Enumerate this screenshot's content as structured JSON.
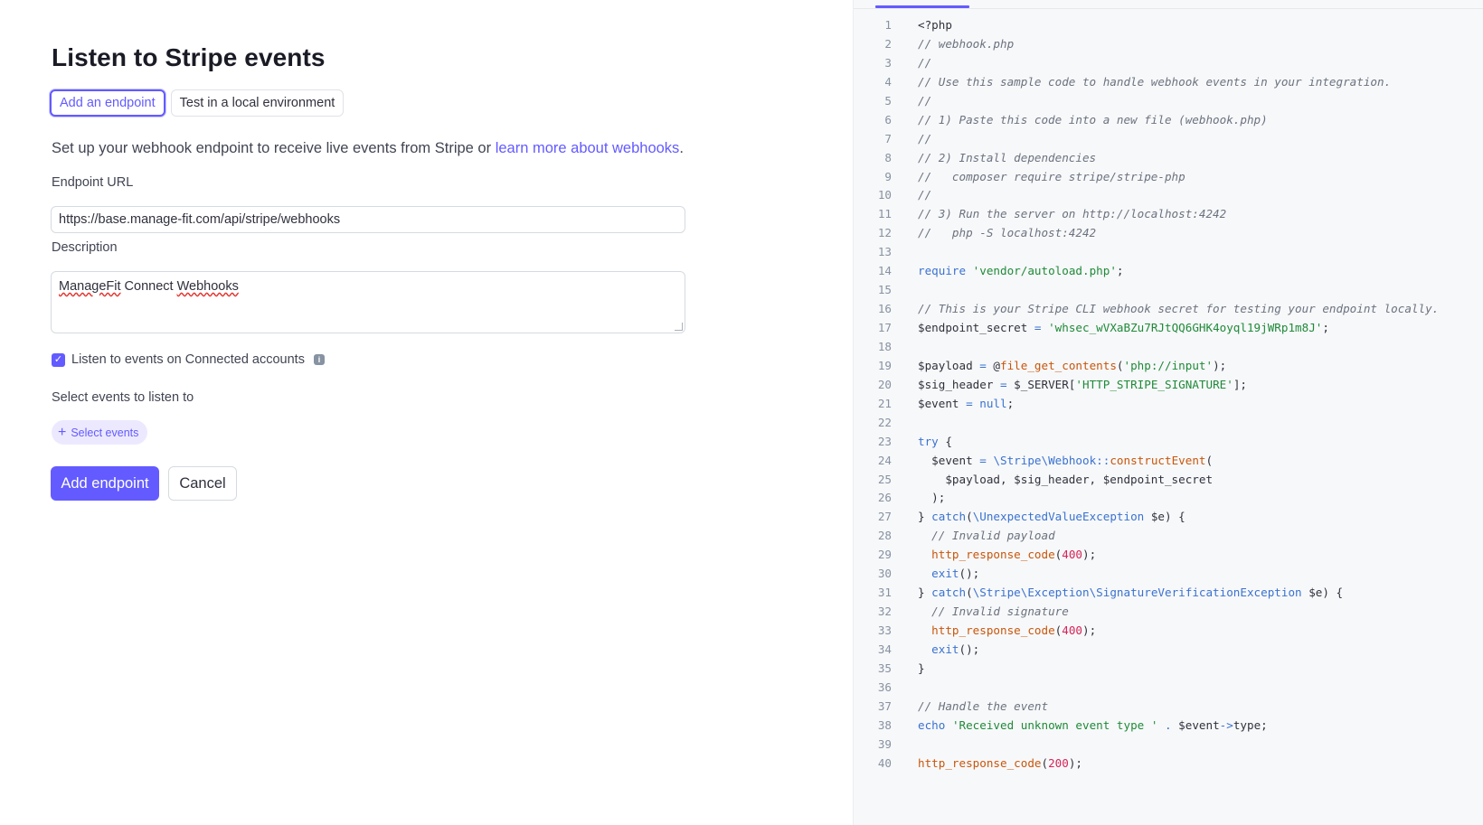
{
  "page": {
    "title": "Listen to Stripe events",
    "tabs": [
      {
        "label": "Add an endpoint",
        "active": true
      },
      {
        "label": "Test in a local environment",
        "active": false
      }
    ],
    "intro_text": "Set up your webhook endpoint to receive live events from Stripe or ",
    "intro_link": "learn more about webhooks",
    "intro_end": "."
  },
  "form": {
    "endpoint_label": "Endpoint URL",
    "endpoint_value": "https://base.manage-fit.com/api/stripe/webhooks",
    "description_label": "Description",
    "description_value_part1": "ManageFit",
    "description_value_part2": " Connect ",
    "description_value_part3": "Webhooks",
    "connected_label": "Listen to events on Connected accounts",
    "connected_checked": true,
    "select_events_label": "Select events to listen to",
    "select_events_button": "Select events",
    "add_button": "Add endpoint",
    "cancel_button": "Cancel"
  },
  "colors": {
    "accent": "#635bff",
    "code_bg": "#f7f8f9"
  },
  "code_lines": [
    [
      [
        "p",
        "<?php"
      ]
    ],
    [
      [
        "c",
        "// webhook.php"
      ]
    ],
    [
      [
        "c",
        "//"
      ]
    ],
    [
      [
        "c",
        "// Use this sample code to handle webhook events in your integration."
      ]
    ],
    [
      [
        "c",
        "//"
      ]
    ],
    [
      [
        "c",
        "// 1) Paste this code into a new file (webhook.php)"
      ]
    ],
    [
      [
        "c",
        "//"
      ]
    ],
    [
      [
        "c",
        "// 2) Install dependencies"
      ]
    ],
    [
      [
        "c",
        "//   composer require stripe/stripe-php"
      ]
    ],
    [
      [
        "c",
        "//"
      ]
    ],
    [
      [
        "c",
        "// 3) Run the server on http://localhost:4242"
      ]
    ],
    [
      [
        "c",
        "//   php -S localhost:4242"
      ]
    ],
    [],
    [
      [
        "k",
        "require"
      ],
      [
        "p",
        " "
      ],
      [
        "s",
        "'vendor/autoload.php'"
      ],
      [
        "p",
        ";"
      ]
    ],
    [],
    [
      [
        "c",
        "// This is your Stripe CLI webhook secret for testing your endpoint locally."
      ]
    ],
    [
      [
        "p",
        "$endpoint_secret "
      ],
      [
        "o",
        "="
      ],
      [
        "p",
        " "
      ],
      [
        "s",
        "'whsec_wVXaBZu7RJtQQ6GHK4oyql19jWRp1m8J'"
      ],
      [
        "p",
        ";"
      ]
    ],
    [],
    [
      [
        "p",
        "$payload "
      ],
      [
        "o",
        "="
      ],
      [
        "p",
        " @"
      ],
      [
        "f",
        "file_get_contents"
      ],
      [
        "p",
        "("
      ],
      [
        "s",
        "'php://input'"
      ],
      [
        "p",
        ");"
      ]
    ],
    [
      [
        "p",
        "$sig_header "
      ],
      [
        "o",
        "="
      ],
      [
        "p",
        " $_SERVER["
      ],
      [
        "s",
        "'HTTP_STRIPE_SIGNATURE'"
      ],
      [
        "p",
        "];"
      ]
    ],
    [
      [
        "p",
        "$event "
      ],
      [
        "o",
        "="
      ],
      [
        "p",
        " "
      ],
      [
        "k",
        "null"
      ],
      [
        "p",
        ";"
      ]
    ],
    [],
    [
      [
        "k",
        "try"
      ],
      [
        "p",
        " {"
      ]
    ],
    [
      [
        "p",
        "  $event "
      ],
      [
        "o",
        "="
      ],
      [
        "p",
        " "
      ],
      [
        "t",
        "\\Stripe\\Webhook"
      ],
      [
        "o",
        "::"
      ],
      [
        "f",
        "constructEvent"
      ],
      [
        "p",
        "("
      ]
    ],
    [
      [
        "p",
        "    $payload, $sig_header, $endpoint_secret"
      ]
    ],
    [
      [
        "p",
        "  );"
      ]
    ],
    [
      [
        "p",
        "} "
      ],
      [
        "k",
        "catch"
      ],
      [
        "p",
        "("
      ],
      [
        "t",
        "\\UnexpectedValueException"
      ],
      [
        "p",
        " $e) {"
      ]
    ],
    [
      [
        "p",
        "  "
      ],
      [
        "c",
        "// Invalid payload"
      ]
    ],
    [
      [
        "p",
        "  "
      ],
      [
        "f",
        "http_response_code"
      ],
      [
        "p",
        "("
      ],
      [
        "n",
        "400"
      ],
      [
        "p",
        ");"
      ]
    ],
    [
      [
        "p",
        "  "
      ],
      [
        "k",
        "exit"
      ],
      [
        "p",
        "();"
      ]
    ],
    [
      [
        "p",
        "} "
      ],
      [
        "k",
        "catch"
      ],
      [
        "p",
        "("
      ],
      [
        "t",
        "\\Stripe\\Exception\\SignatureVerificationException"
      ],
      [
        "p",
        " $e) {"
      ]
    ],
    [
      [
        "p",
        "  "
      ],
      [
        "c",
        "// Invalid signature"
      ]
    ],
    [
      [
        "p",
        "  "
      ],
      [
        "f",
        "http_response_code"
      ],
      [
        "p",
        "("
      ],
      [
        "n",
        "400"
      ],
      [
        "p",
        ");"
      ]
    ],
    [
      [
        "p",
        "  "
      ],
      [
        "k",
        "exit"
      ],
      [
        "p",
        "();"
      ]
    ],
    [
      [
        "p",
        "}"
      ]
    ],
    [],
    [
      [
        "c",
        "// Handle the event"
      ]
    ],
    [
      [
        "k",
        "echo"
      ],
      [
        "p",
        " "
      ],
      [
        "s",
        "'Received unknown event type '"
      ],
      [
        "p",
        " "
      ],
      [
        "o",
        "."
      ],
      [
        "p",
        " $event"
      ],
      [
        "o",
        "->"
      ],
      [
        "p",
        "type;"
      ]
    ],
    [],
    [
      [
        "f",
        "http_response_code"
      ],
      [
        "p",
        "("
      ],
      [
        "n",
        "200"
      ],
      [
        "p",
        ");"
      ]
    ]
  ]
}
